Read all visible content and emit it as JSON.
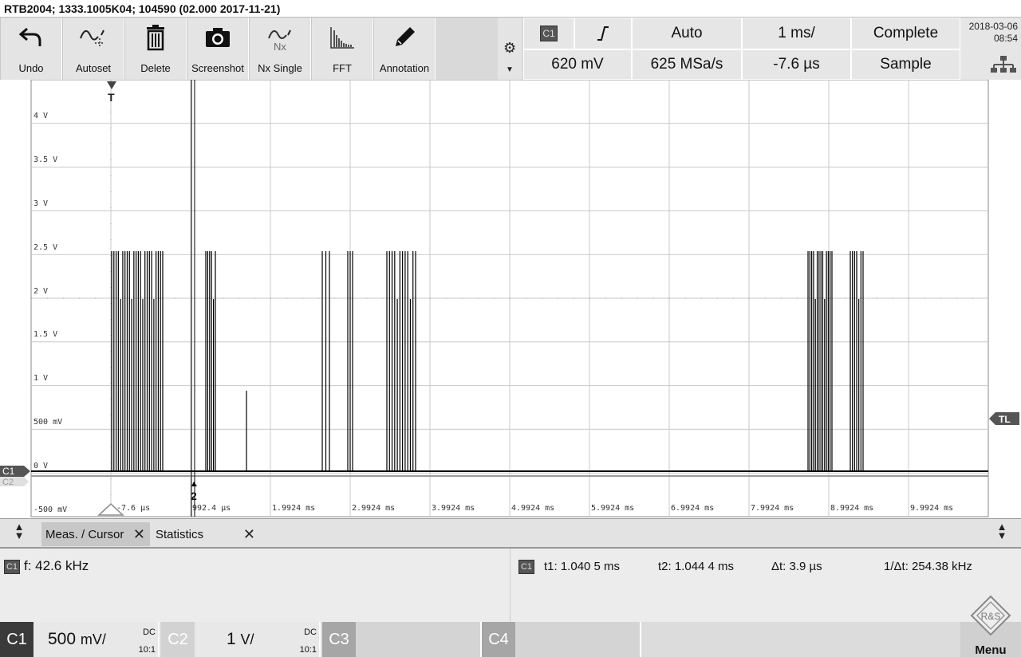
{
  "title": "RTB2004; 1333.1005K04; 104590 (02.000 2017-11-21)",
  "toolbar": {
    "buttons": [
      {
        "label": "Undo",
        "icon": "undo-icon"
      },
      {
        "label": "Autoset",
        "icon": "autoset-icon"
      },
      {
        "label": "Delete",
        "icon": "trash-icon"
      },
      {
        "label": "Screenshot",
        "icon": "camera-icon"
      },
      {
        "label": "Nx Single",
        "icon": "nx-single-icon"
      },
      {
        "label": "FFT",
        "icon": "fft-icon"
      },
      {
        "label": "Annotation",
        "icon": "pencil-icon"
      }
    ],
    "nx_glyph": "Nx"
  },
  "settings": {
    "channel": "C1",
    "trigger_type": "rising-edge",
    "trigger_mode": "Auto",
    "timebase": "1 ms/",
    "acq_status": "Complete",
    "trigger_level": "620 mV",
    "sample_rate": "625 MSa/s",
    "trigger_offset": "-7.6 µs",
    "acq_mode": "Sample",
    "date": "2018-03-06",
    "time": "08:54"
  },
  "plot": {
    "y_labels": [
      "4 V",
      "3.5 V",
      "3 V",
      "2.5 V",
      "2 V",
      "1.5 V",
      "1 V",
      "500 mV",
      "0 V",
      "-500 mV"
    ],
    "x_labels": [
      "-7.6 µs",
      "992.4 µs",
      "1.9924 ms",
      "2.9924 ms",
      "3.9924 ms",
      "4.9924 ms",
      "5.9924 ms",
      "6.9924 ms",
      "7.9924 ms",
      "8.9924 ms",
      "9.9924 ms"
    ],
    "trigger_marker": "T",
    "cursor_marker": "2",
    "tl_marker": "TL",
    "c1_marker": "C1",
    "c2_marker": "C2",
    "colors": {
      "trace_c1": "#000000",
      "trace_c2": "#9a9a9a",
      "grid": "#c8c8c8"
    }
  },
  "tabs": [
    {
      "label": "Meas. / Cursor",
      "close": "✕"
    },
    {
      "label": "Statistics",
      "close": "✕"
    }
  ],
  "measurements": {
    "left_channel": "C1",
    "freq": "f: 42.6 kHz",
    "right_channel": "C1",
    "t1": "t1: 1.040 5 ms",
    "t2": "t2: 1.044 4 ms",
    "dt": "Δt: 3.9 µs",
    "inv_dt": "1/Δt: 254.38 kHz"
  },
  "channels": [
    {
      "name": "C1",
      "scale": "500",
      "unit": "mV/",
      "coupling": "DC",
      "probe": "10:1"
    },
    {
      "name": "C2",
      "scale": "1",
      "unit": "V/",
      "coupling": "DC",
      "probe": "10:1"
    },
    {
      "name": "C3"
    },
    {
      "name": "C4"
    }
  ],
  "menu": {
    "label": "Menu",
    "logo": "R&S"
  }
}
